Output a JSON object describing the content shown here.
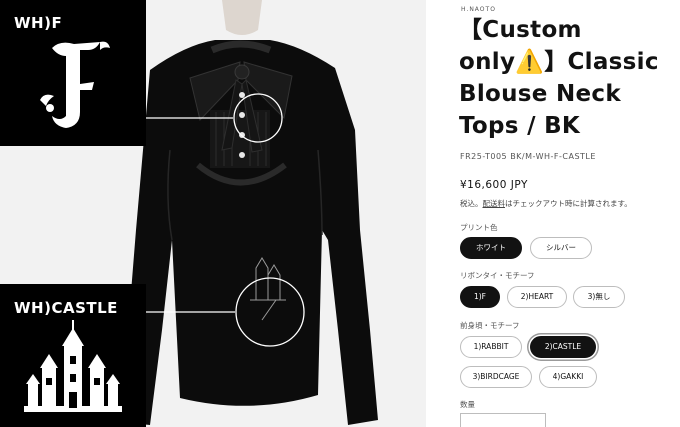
{
  "photo": {
    "detail_top_label": "WH)F",
    "detail_bottom_label": "WH)CASTLE",
    "monogram_icon": "fraktur-f-icon",
    "castle_icon": "castle-icon"
  },
  "product": {
    "vendor": "H.NAOTO",
    "title": "【Custom only⚠️】Classic Blouse Neck Tops / BK",
    "sku": "FR25-T005 BK/M-WH-F-CASTLE",
    "price": "¥16,600 JPY",
    "tax_prefix": "税込。",
    "tax_link": "配送料",
    "tax_suffix": "はチェックアウト時に計算されます。"
  },
  "options": {
    "print_color": {
      "label": "プリント色",
      "values": [
        "ホワイト",
        "シルバー"
      ],
      "selected": "ホワイト"
    },
    "ribbon_motif": {
      "label": "リボンタイ・モチーフ",
      "values": [
        "1)F",
        "2)HEART",
        "3)無し"
      ],
      "selected": "1)F"
    },
    "front_motif": {
      "label": "前身頃・モチーフ",
      "values": [
        "1)RABBIT",
        "2)CASTLE",
        "3)BIRDCAGE",
        "4)GAKKI"
      ],
      "selected": "2)CASTLE"
    },
    "quantity": {
      "label": "数量"
    }
  },
  "colors": {
    "primary": "#121212",
    "background": "#ffffff",
    "border": "#bdbdbd",
    "photo_bg": "#f2f2f2"
  }
}
